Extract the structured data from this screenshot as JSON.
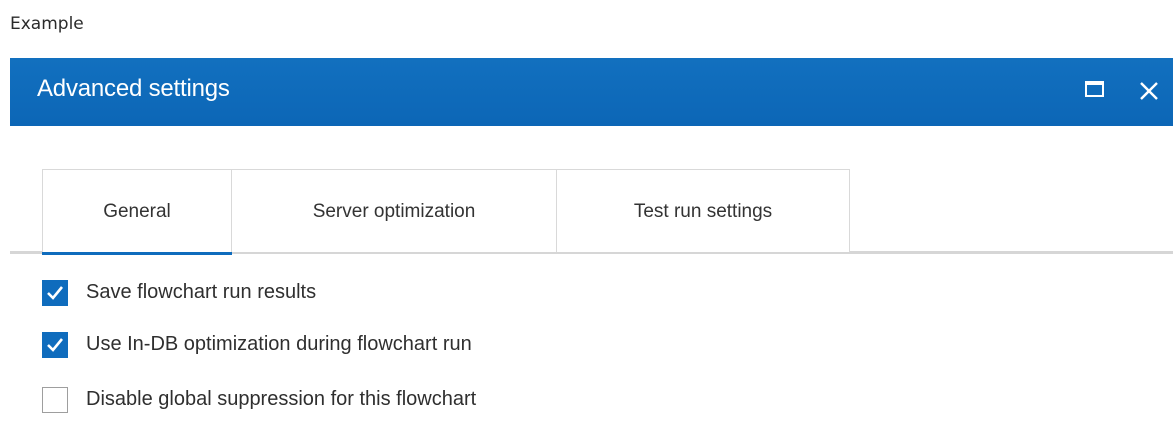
{
  "caption": "Example",
  "dialog": {
    "title": "Advanced settings",
    "window_controls": [
      {
        "name": "maximize",
        "icon": "maximize-icon"
      },
      {
        "name": "close",
        "icon": "close-icon"
      }
    ]
  },
  "tabs": {
    "active": "General",
    "items": [
      {
        "label": "General"
      },
      {
        "label": "Server optimization"
      },
      {
        "label": "Test run settings"
      }
    ]
  },
  "options": [
    {
      "label": "Save flowchart run results",
      "checked": true
    },
    {
      "label": "Use In-DB optimization during flowchart run",
      "checked": true
    },
    {
      "label": "Disable global suppression for this flowchart",
      "checked": false
    }
  ],
  "colors": {
    "accent": "#0f6cbd",
    "title_text": "#ffffff",
    "tab_border": "#d9d9d9"
  }
}
